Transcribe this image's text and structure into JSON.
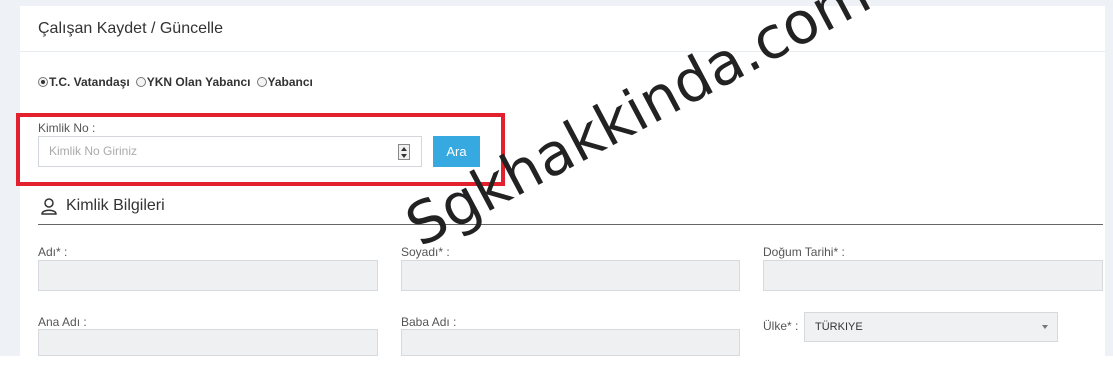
{
  "header": {
    "title": "Çalışan Kaydet / Güncelle"
  },
  "citizenship": {
    "options": [
      {
        "label": "T.C. Vatandaşı",
        "checked": true
      },
      {
        "label": "YKN Olan Yabancı",
        "checked": false
      },
      {
        "label": "Yabancı",
        "checked": false
      }
    ]
  },
  "identity_search": {
    "label": "Kimlik No :",
    "placeholder": "Kimlik No Giriniz",
    "button_label": "Ara"
  },
  "section": {
    "title": "Kimlik Bilgileri"
  },
  "fields": {
    "name_label": "Adı* :",
    "surname_label": "Soyadı* :",
    "birthdate_label": "Doğum Tarihi* :",
    "mother_label": "Ana Adı :",
    "father_label": "Baba Adı :",
    "country_label": "Ülke* :",
    "country_value": "TÜRKIYE"
  },
  "watermark": "Sgkhakkinda.com",
  "colors": {
    "highlight": "#e3202e",
    "button": "#36a9e1"
  }
}
